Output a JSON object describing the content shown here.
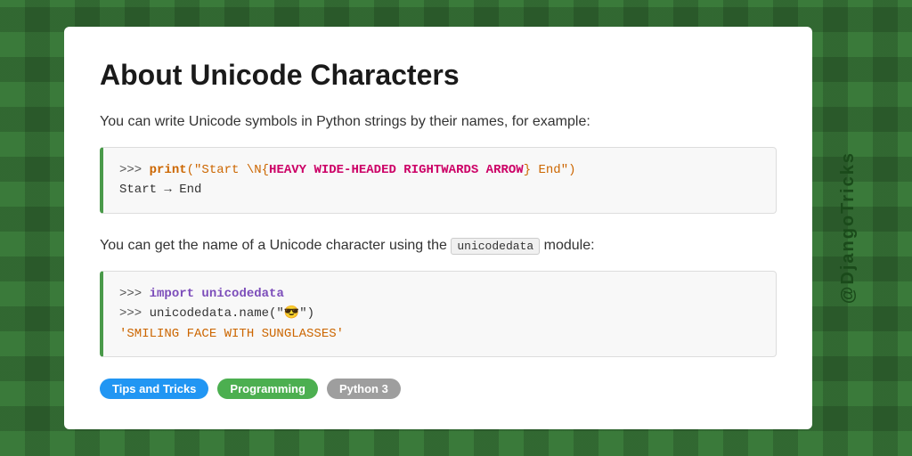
{
  "page": {
    "title": "About Unicode Characters",
    "background_color": "#3a7a3a"
  },
  "content": {
    "paragraph1": "You can write Unicode symbols in Python strings by their names, for example:",
    "code_block1": {
      "line1_prompt": ">>> ",
      "line1_keyword": "print",
      "line1_string_open": "(\"Start \\N{",
      "line1_string_name": "HEAVY WIDE-HEADED RIGHTWARDS ARROW",
      "line1_string_close": "} End\")",
      "line2_output": "Start → End"
    },
    "paragraph2_before": "You can get the name of a Unicode character using the ",
    "paragraph2_code": "unicodedata",
    "paragraph2_after": " module:",
    "code_block2": {
      "line1_prompt": ">>> ",
      "line1_keyword": "import",
      "line1_module": " unicodedata",
      "line2_prompt": ">>> ",
      "line2_code": "unicodedata.name(\"😎\")",
      "line3_result": "'SMILING FACE WITH SUNGLASSES'"
    }
  },
  "tags": [
    {
      "label": "Tips and Tricks",
      "class": "tag-tips"
    },
    {
      "label": "Programming",
      "class": "tag-programming"
    },
    {
      "label": "Python 3",
      "class": "tag-python"
    }
  ],
  "sidebar": {
    "handle": "@DjangoTricks"
  }
}
